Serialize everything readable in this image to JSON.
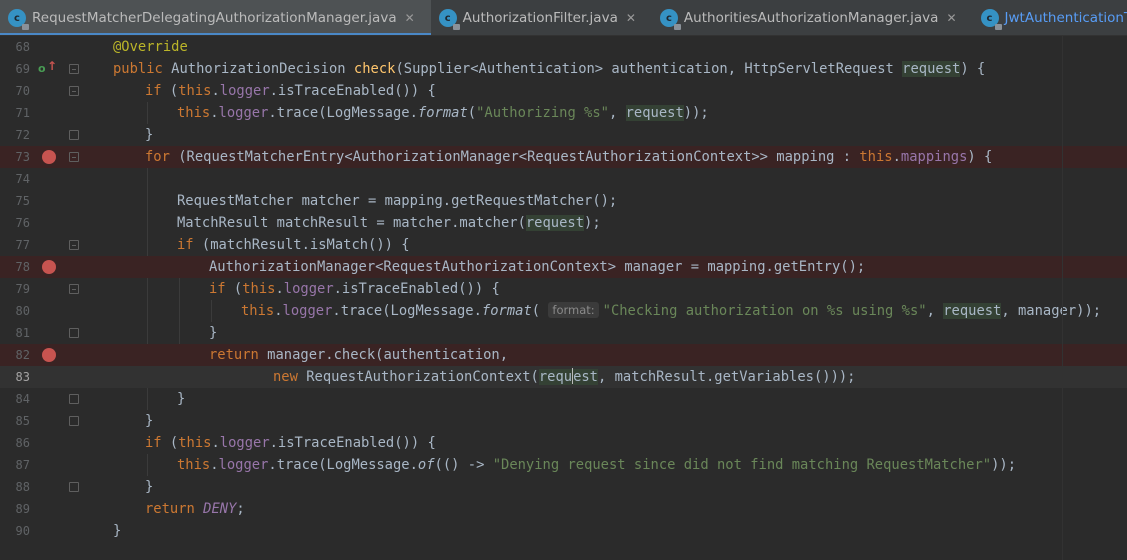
{
  "tabs": [
    {
      "label": "RequestMatcherDelegatingAuthorizationManager.java",
      "close": "✕",
      "active": true
    },
    {
      "label": "AuthorizationFilter.java",
      "close": "✕",
      "active": false
    },
    {
      "label": "AuthoritiesAuthorizationManager.java",
      "close": "✕",
      "active": false
    },
    {
      "label": "JwtAuthenticationToken.java",
      "close": "✕",
      "active": false
    }
  ],
  "tab_icon_glyph": "c",
  "colors": {
    "keyword": "#cc7832",
    "annotation": "#bbb529",
    "method_decl": "#ffc66d",
    "field": "#9876aa",
    "string": "#6a8759",
    "plain": "#a9b7c6",
    "breakpoint": "#c75450",
    "active_tab_underline": "#4a88c7"
  },
  "gutter_icons": {
    "override": "o",
    "override_arrow": "↑"
  },
  "lines": [
    {
      "n": "68",
      "parts": [
        {
          "t": "@Override",
          "c": "ann"
        }
      ]
    },
    {
      "n": "69",
      "parts": [
        {
          "t": "public ",
          "c": "kw"
        },
        {
          "t": "AuthorizationDecision "
        },
        {
          "t": "check",
          "c": "fn"
        },
        {
          "t": "(Supplier<Authentication> authentication, HttpServletRequest "
        },
        {
          "t": "request",
          "c": "hl"
        },
        {
          "t": ") {"
        }
      ]
    },
    {
      "n": "70",
      "parts": [
        {
          "t": "if ",
          "c": "kw"
        },
        {
          "t": "("
        },
        {
          "t": "this",
          "c": "kw"
        },
        {
          "t": "."
        },
        {
          "t": "logger",
          "c": "fld"
        },
        {
          "t": ".isTraceEnabled()) {"
        }
      ]
    },
    {
      "n": "71",
      "parts": [
        {
          "t": "this",
          "c": "kw"
        },
        {
          "t": "."
        },
        {
          "t": "logger",
          "c": "fld"
        },
        {
          "t": ".trace(LogMessage."
        },
        {
          "t": "format",
          "c": "ital"
        },
        {
          "t": "("
        },
        {
          "t": "\"Authorizing %s\"",
          "c": "str"
        },
        {
          "t": ", "
        },
        {
          "t": "request",
          "c": "hl"
        },
        {
          "t": "));"
        }
      ]
    },
    {
      "n": "72",
      "parts": [
        {
          "t": "}"
        }
      ]
    },
    {
      "n": "73",
      "parts": [
        {
          "t": "for ",
          "c": "kw"
        },
        {
          "t": "(RequestMatcherEntry<AuthorizationManager<RequestAuthorizationContext>> mapping : "
        },
        {
          "t": "this",
          "c": "kw"
        },
        {
          "t": "."
        },
        {
          "t": "mappings",
          "c": "fld"
        },
        {
          "t": ") {"
        }
      ]
    },
    {
      "n": "74",
      "parts": []
    },
    {
      "n": "75",
      "parts": [
        {
          "t": "RequestMatcher matcher = mapping.getRequestMatcher();"
        }
      ]
    },
    {
      "n": "76",
      "parts": [
        {
          "t": "MatchResult matchResult = matcher.matcher("
        },
        {
          "t": "request",
          "c": "hl"
        },
        {
          "t": ");"
        }
      ]
    },
    {
      "n": "77",
      "parts": [
        {
          "t": "if ",
          "c": "kw"
        },
        {
          "t": "(matchResult.isMatch()) {"
        }
      ]
    },
    {
      "n": "78",
      "parts": [
        {
          "t": "AuthorizationManager<RequestAuthorizationContext> manager = mapping.getEntry();"
        }
      ]
    },
    {
      "n": "79",
      "parts": [
        {
          "t": "if ",
          "c": "kw"
        },
        {
          "t": "("
        },
        {
          "t": "this",
          "c": "kw"
        },
        {
          "t": "."
        },
        {
          "t": "logger",
          "c": "fld"
        },
        {
          "t": ".isTraceEnabled()) {"
        }
      ]
    },
    {
      "n": "80",
      "parts": [
        {
          "t": "this",
          "c": "kw"
        },
        {
          "t": "."
        },
        {
          "t": "logger",
          "c": "fld"
        },
        {
          "t": ".trace(LogMessage."
        },
        {
          "t": "format",
          "c": "ital"
        },
        {
          "t": "( "
        },
        {
          "t": "format:",
          "c": "hint"
        },
        {
          "t": "\"Checking authorization on %s using %s\"",
          "c": "str"
        },
        {
          "t": ", "
        },
        {
          "t": "request",
          "c": "hl"
        },
        {
          "t": ", manager));"
        }
      ]
    },
    {
      "n": "81",
      "parts": [
        {
          "t": "}"
        }
      ]
    },
    {
      "n": "82",
      "parts": [
        {
          "t": "return ",
          "c": "kw"
        },
        {
          "t": "manager.check(authentication,"
        }
      ]
    },
    {
      "n": "83",
      "parts": [
        {
          "t": "new ",
          "c": "kw"
        },
        {
          "t": "RequestAuthorizationContext("
        },
        {
          "t": "requ",
          "c": "hl"
        },
        {
          "t": "",
          "c": "cursor"
        },
        {
          "t": "est",
          "c": "hl"
        },
        {
          "t": ", matchResult.getVariables()));"
        }
      ]
    },
    {
      "n": "84",
      "parts": [
        {
          "t": "}"
        }
      ]
    },
    {
      "n": "85",
      "parts": [
        {
          "t": "}"
        }
      ]
    },
    {
      "n": "86",
      "parts": [
        {
          "t": "if ",
          "c": "kw"
        },
        {
          "t": "("
        },
        {
          "t": "this",
          "c": "kw"
        },
        {
          "t": "."
        },
        {
          "t": "logger",
          "c": "fld"
        },
        {
          "t": ".isTraceEnabled()) {"
        }
      ]
    },
    {
      "n": "87",
      "parts": [
        {
          "t": "this",
          "c": "kw"
        },
        {
          "t": "."
        },
        {
          "t": "logger",
          "c": "fld"
        },
        {
          "t": ".trace(LogMessage."
        },
        {
          "t": "of",
          "c": "ital"
        },
        {
          "t": "(() -> "
        },
        {
          "t": "\"Denying request since did not find matching RequestMatcher\"",
          "c": "str"
        },
        {
          "t": "));"
        }
      ]
    },
    {
      "n": "88",
      "parts": [
        {
          "t": "}"
        }
      ]
    },
    {
      "n": "89",
      "parts": [
        {
          "t": "return ",
          "c": "kw"
        },
        {
          "t": "DENY",
          "c": "const"
        },
        {
          "t": ";"
        }
      ]
    },
    {
      "n": "90",
      "parts": [
        {
          "t": "}"
        }
      ]
    }
  ]
}
